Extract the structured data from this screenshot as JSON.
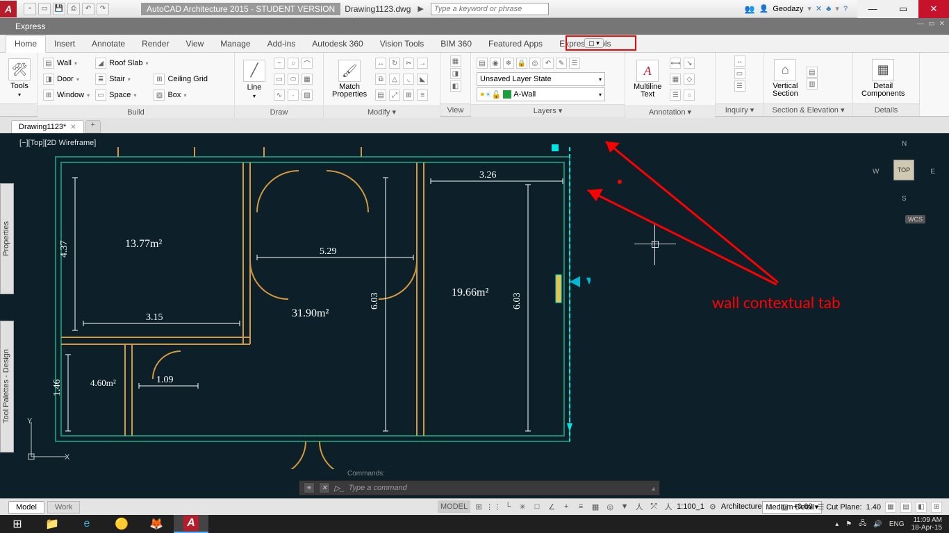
{
  "titlebar": {
    "app_title": "AutoCAD Architecture 2015 - STUDENT VERSION",
    "filename": "Drawing1123.dwg",
    "search_placeholder": "Type a keyword or phrase",
    "username": "Geodazy"
  },
  "express_bar": {
    "label": "Express"
  },
  "ribbon_tabs": [
    "Home",
    "Insert",
    "Annotate",
    "Render",
    "View",
    "Manage",
    "Add-ins",
    "Autodesk 360",
    "Vision Tools",
    "BIM 360",
    "Featured Apps",
    "Express Tools"
  ],
  "ribbon": {
    "tools": {
      "label": "Tools"
    },
    "build": {
      "title": "Build",
      "wall": "Wall",
      "door": "Door",
      "window": "Window",
      "roofslab": "Roof Slab",
      "stair": "Stair",
      "space": "Space",
      "ceiling": "Ceiling Grid",
      "box": "Box"
    },
    "draw": {
      "title": "Draw",
      "line": "Line"
    },
    "modify": {
      "title": "Modify ▾",
      "match": "Match\nProperties"
    },
    "view": {
      "title": "View"
    },
    "layers": {
      "title": "Layers ▾",
      "state": "Unsaved Layer State",
      "current": "A-Wall"
    },
    "annotation": {
      "title": "Annotation ▾",
      "mtext": "Multiline\nText"
    },
    "inquiry": {
      "title": "Inquiry ▾"
    },
    "section": {
      "title": "Section & Elevation ▾",
      "vsection": "Vertical\nSection"
    },
    "details": {
      "title": "Details",
      "detail": "Detail\nComponents"
    }
  },
  "file_tabs": {
    "drawing": "Drawing1123*"
  },
  "canvas": {
    "view_label": "[−][Top][2D Wireframe]",
    "compass": {
      "top": "TOP",
      "n": "N",
      "s": "S",
      "e": "E",
      "w": "W"
    },
    "wcs": "WCS",
    "ucs_x": "X",
    "ucs_y": "Y",
    "annotation": "wall contextual tab",
    "commands_label": "Commands:"
  },
  "plan": {
    "areas": {
      "r1": "13.77m²",
      "r2": "31.90m²",
      "r3": "19.66m²",
      "r4": "4.60m²"
    },
    "dims": {
      "d437": "4.37",
      "d315": "3.15",
      "d529": "5.29",
      "d603a": "6.03",
      "d603b": "6.03",
      "d326": "3.26",
      "d146": "1.46",
      "d109": "1.09"
    }
  },
  "cmdline": {
    "placeholder": "Type a command"
  },
  "statusbar": {
    "model_tab": "Model",
    "work_tab": "Work",
    "model_btn": "MODEL",
    "scale": "1:100_1",
    "workspace": "Architecture",
    "elev": "+0.00",
    "detail": "Medium Detail",
    "cutplane_label": "Cut Plane:",
    "cutplane_val": "1.40"
  },
  "taskbar": {
    "lang": "ENG",
    "time": "11:09 AM",
    "date": "18-Apr-15"
  }
}
